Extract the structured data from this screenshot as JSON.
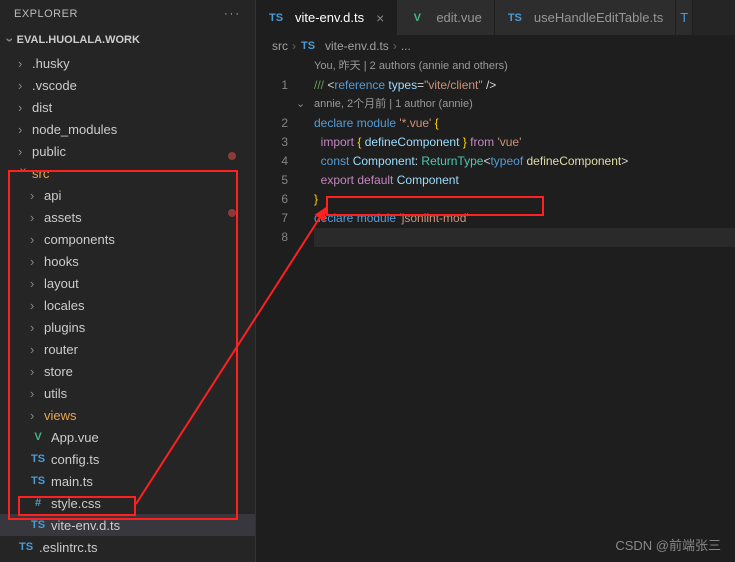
{
  "explorer": {
    "title": "EXPLORER"
  },
  "workspace": {
    "name": "EVAL.HUOLALA.WORK"
  },
  "tree": {
    "top": [
      ".husky",
      ".vscode",
      "dist",
      "node_modules",
      "public"
    ],
    "src": "src",
    "srcChildren": [
      "api",
      "assets",
      "components",
      "hooks",
      "layout",
      "locales",
      "plugins",
      "router",
      "store",
      "utils",
      "views"
    ],
    "files": {
      "appvue": "App.vue",
      "configts": "config.ts",
      "maints": "main.ts",
      "stylecss": "style.css",
      "viteenv": "vite-env.d.ts",
      "eslint": ".eslintrc.ts"
    }
  },
  "tabs": {
    "t1": "vite-env.d.ts",
    "t2": "edit.vue",
    "t3": "useHandleEditTable.ts"
  },
  "breadcrumb": {
    "p1": "src",
    "p2": "vite-env.d.ts",
    "p3": "..."
  },
  "codelens": {
    "top": "You, 昨天 | 2 authors (annie and others)",
    "mid": "annie, 2个月前 | 1 author (annie)"
  },
  "code": {
    "l1": {
      "a": "/// ",
      "b": "<",
      "c": "reference",
      "d": " types",
      "e": "=",
      "f": "\"vite/client\"",
      "g": " />"
    },
    "l2": {
      "a": "declare",
      "b": " module",
      "c": " '*.vue'",
      "d": " {"
    },
    "l3": {
      "a": "  import",
      "b": " { ",
      "c": "defineComponent",
      "d": " } ",
      "e": "from",
      "f": " 'vue'"
    },
    "l4": {
      "a": "  const",
      "b": " Component",
      "c": ": ",
      "d": "ReturnType",
      "e": "<",
      "f": "typeof",
      "g": " defineComponent",
      "h": ">"
    },
    "l5": {
      "a": "  export",
      "b": " default",
      "c": " Component"
    },
    "l6": "}",
    "l7": {
      "a": "declare",
      "b": " module",
      "c": " 'jsonlint-mod'"
    }
  },
  "watermark": "CSDN @前端张三"
}
